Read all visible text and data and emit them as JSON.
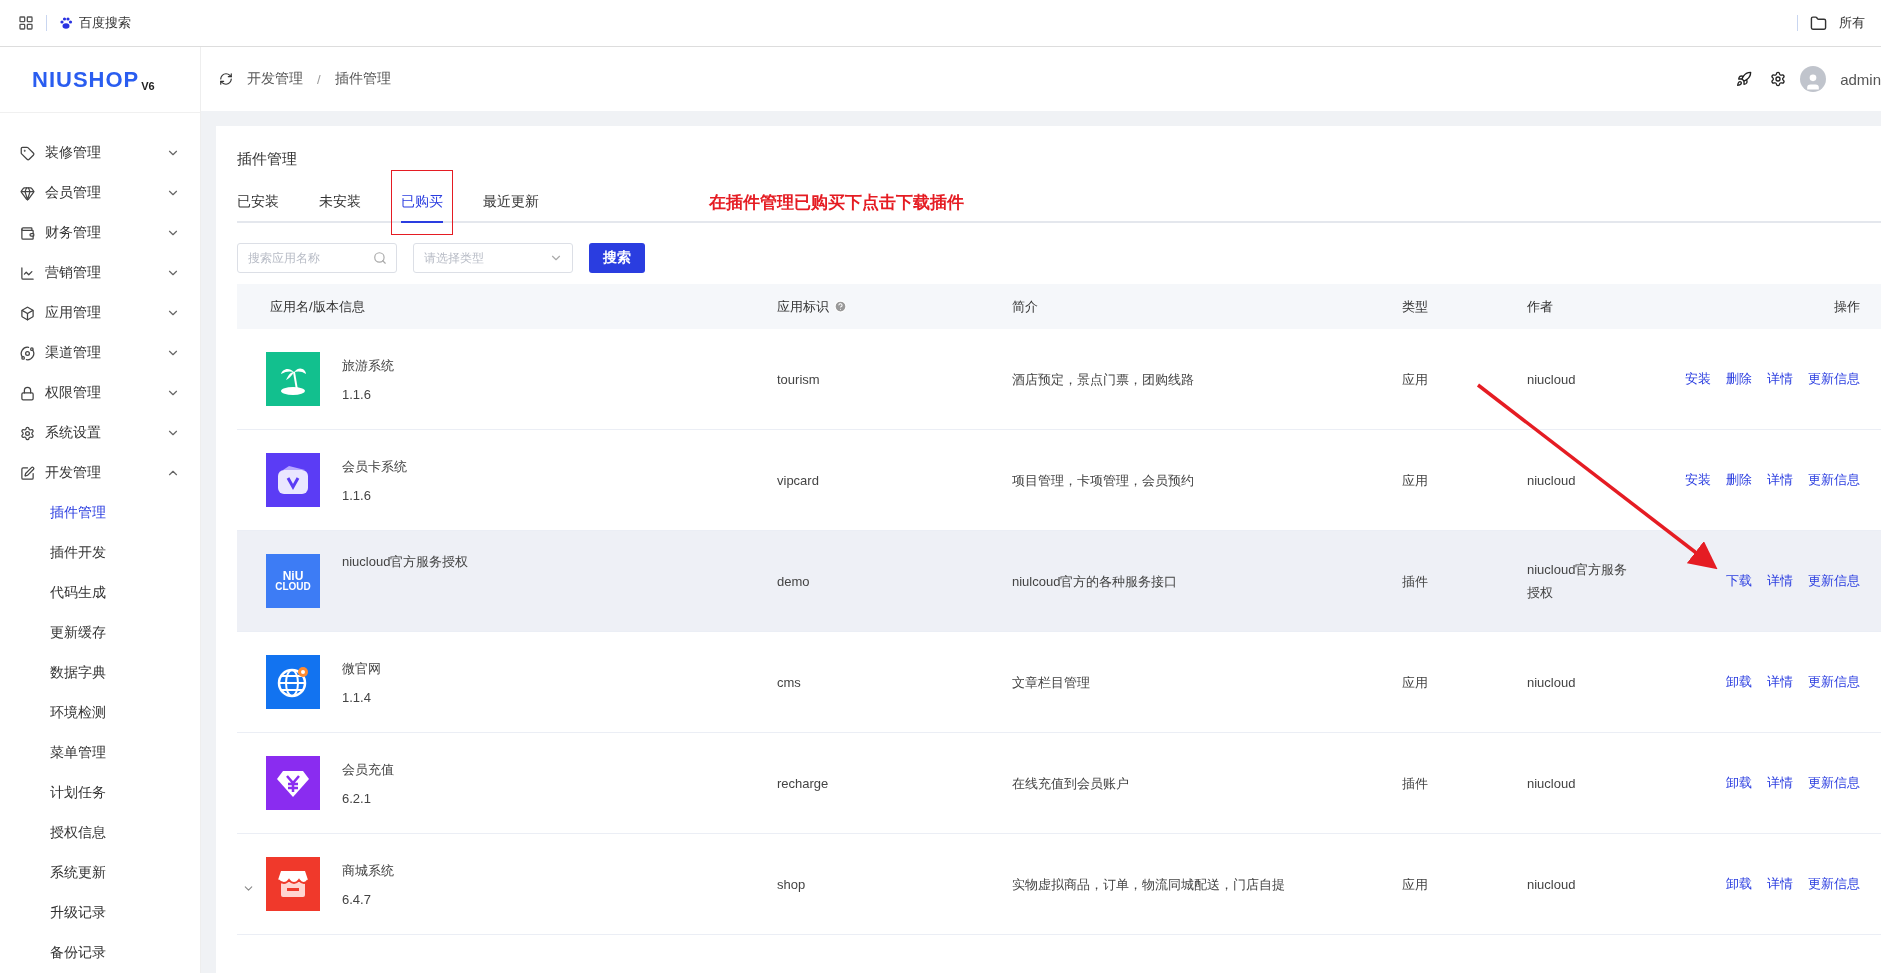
{
  "bookmarks_bar": {
    "items": [
      {
        "kind": "apps"
      },
      {
        "kind": "link",
        "label": "百度搜索"
      }
    ],
    "right_folder": "所有"
  },
  "logo": {
    "text": "NIUSHOP",
    "badge": "V6"
  },
  "sidebar": {
    "items": [
      {
        "label": "装修管理",
        "expanded": false
      },
      {
        "label": "会员管理",
        "expanded": false
      },
      {
        "label": "财务管理",
        "expanded": false
      },
      {
        "label": "营销管理",
        "expanded": false
      },
      {
        "label": "应用管理",
        "expanded": false
      },
      {
        "label": "渠道管理",
        "expanded": false
      },
      {
        "label": "权限管理",
        "expanded": false
      },
      {
        "label": "系统设置",
        "expanded": false
      },
      {
        "label": "开发管理",
        "expanded": true,
        "children": [
          {
            "label": "插件管理",
            "selected": true
          },
          {
            "label": "插件开发",
            "selected": false
          },
          {
            "label": "代码生成",
            "selected": false
          },
          {
            "label": "更新缓存",
            "selected": false
          },
          {
            "label": "数据字典",
            "selected": false
          },
          {
            "label": "环境检测",
            "selected": false
          },
          {
            "label": "菜单管理",
            "selected": false
          },
          {
            "label": "计划任务",
            "selected": false
          },
          {
            "label": "授权信息",
            "selected": false
          },
          {
            "label": "系统更新",
            "selected": false
          },
          {
            "label": "升级记录",
            "selected": false
          },
          {
            "label": "备份记录",
            "selected": false
          }
        ]
      }
    ]
  },
  "header": {
    "breadcrumb": [
      "开发管理",
      "插件管理"
    ],
    "separator": "/",
    "user": "admin"
  },
  "page_title": "插件管理",
  "tabs": [
    {
      "label": "已安装",
      "selected": false
    },
    {
      "label": "未安装",
      "selected": false
    },
    {
      "label": "已购买",
      "selected": true,
      "highlighted": true
    },
    {
      "label": "最近更新",
      "selected": false
    }
  ],
  "annotation": "在插件管理已购买下点击下载插件",
  "search": {
    "placeholder": "搜索应用名称",
    "type_placeholder": "请选择类型",
    "button": "搜索"
  },
  "table": {
    "columns": [
      "应用名/版本信息",
      "应用标识",
      "简介",
      "类型",
      "作者",
      "操作"
    ],
    "rows": [
      {
        "kind": "palm",
        "color": "#12c08e",
        "name": "旅游系统",
        "version": "1.1.6",
        "key": "tourism",
        "intro": "酒店预定，景点门票，团购线路",
        "type": "应用",
        "author": "niucloud",
        "actions": [
          "安装",
          "删除",
          "详情",
          "更新信息"
        ],
        "highlighted": false,
        "expandable": false
      },
      {
        "kind": "card",
        "color": "#5b3cf5",
        "name": "会员卡系统",
        "version": "1.1.6",
        "key": "vipcard",
        "intro": "项目管理，卡项管理，会员预约",
        "type": "应用",
        "author": "niucloud",
        "actions": [
          "安装",
          "删除",
          "详情",
          "更新信息"
        ],
        "highlighted": false,
        "expandable": false
      },
      {
        "kind": "text",
        "logo_text": [
          "NiU",
          "CLOUD"
        ],
        "color": "#3d7cf5",
        "name": "niucloud官方服务授权",
        "key": "demo",
        "intro": "niulcoud官方的各种服务接口",
        "type": "插件",
        "author": "niucloud官方服务授权",
        "actions": [
          "下载",
          "详情",
          "更新信息"
        ],
        "highlighted": true,
        "expandable": false
      },
      {
        "kind": "globe",
        "color": "#1273f0",
        "name": "微官网",
        "version": "1.1.4",
        "key": "cms",
        "intro": "文章栏目管理",
        "type": "应用",
        "author": "niucloud",
        "actions": [
          "卸载",
          "详情",
          "更新信息"
        ],
        "highlighted": false,
        "expandable": false
      },
      {
        "kind": "yuan",
        "color": "#8a2cf0",
        "name": "会员充值",
        "version": "6.2.1",
        "key": "recharge",
        "intro": "在线充值到会员账户",
        "type": "插件",
        "author": "niucloud",
        "actions": [
          "卸载",
          "详情",
          "更新信息"
        ],
        "highlighted": false,
        "expandable": false
      },
      {
        "kind": "shop",
        "color": "#f0392b",
        "name": "商城系统",
        "version": "6.4.7",
        "key": "shop",
        "intro": "实物虚拟商品，订单，物流同城配送，门店自提",
        "type": "应用",
        "author": "niucloud",
        "actions": [
          "卸载",
          "详情",
          "更新信息"
        ],
        "highlighted": false,
        "expandable": true
      }
    ]
  }
}
